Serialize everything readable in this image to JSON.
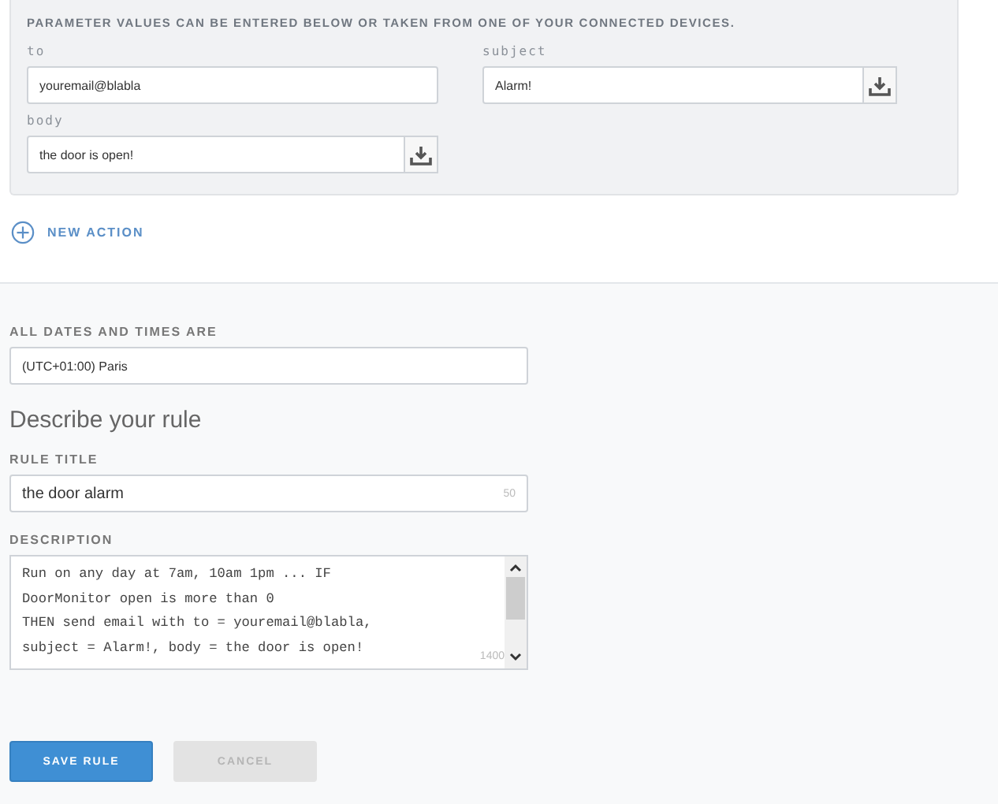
{
  "parameters": {
    "heading": "PARAMETER VALUES CAN BE ENTERED BELOW OR TAKEN FROM ONE OF YOUR CONNECTED DEVICES.",
    "fields": [
      {
        "label": "to",
        "value": "youremail@blabla",
        "device_picker": false
      },
      {
        "label": "subject",
        "value": "Alarm!",
        "device_picker": true
      },
      {
        "label": "body",
        "value": "the door is open!",
        "device_picker": true
      }
    ]
  },
  "new_action": {
    "label": "NEW ACTION"
  },
  "timezone": {
    "label": "ALL DATES AND TIMES ARE",
    "value": "(UTC+01:00) Paris"
  },
  "rule_heading": "Describe your rule",
  "rule_title": {
    "label": "RULE TITLE",
    "value": "the door alarm",
    "counter": "50"
  },
  "description": {
    "label": "DESCRIPTION",
    "lines": [
      "Run on any day at 7am, 10am 1pm ... IF",
      "DoorMonitor open is more than 0",
      "THEN send email with to = youremail@blabla,",
      "subject = Alarm!, body = the door is open!"
    ],
    "counter": "1400"
  },
  "buttons": [
    {
      "label": "SAVE RULE",
      "kind": "primary",
      "disabled": false
    },
    {
      "label": "CANCEL",
      "kind": "secondary",
      "disabled": true
    }
  ]
}
